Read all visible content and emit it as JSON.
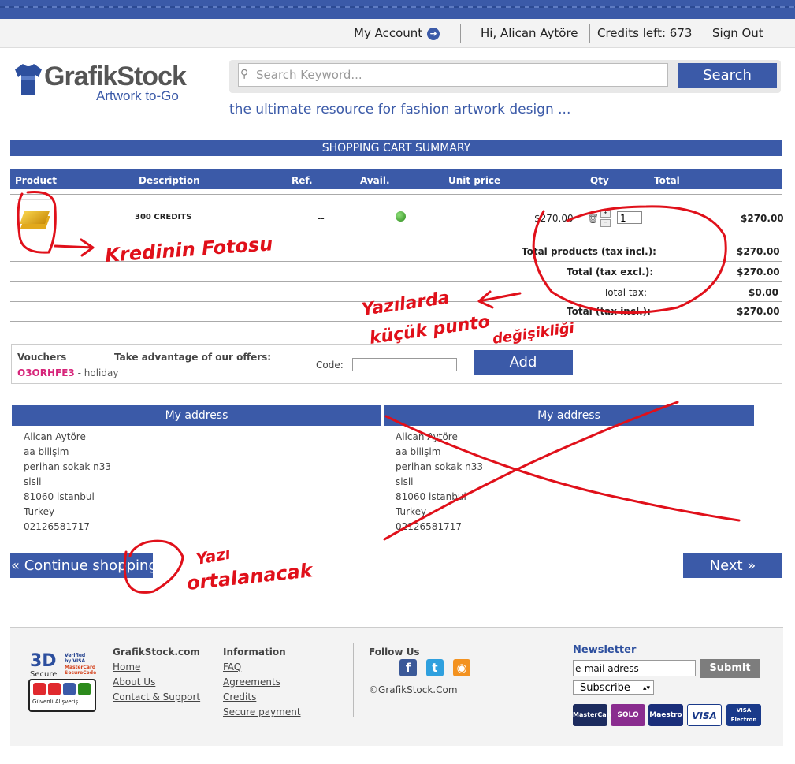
{
  "topbar": {
    "my_account": "My Account",
    "greeting": "Hi, Alican Aytöre",
    "credits": "Credits left: 673",
    "sign_out": "Sign Out"
  },
  "header": {
    "logo_text": "GrafikStock",
    "logo_sub": "Artwork to-Go",
    "search_placeholder": "Search Keyword...",
    "search_button": "Search",
    "tagline": "the ultimate resource for fashion artwork design ..."
  },
  "cart": {
    "title": "SHOPPING CART SUMMARY",
    "columns": [
      "Product",
      "Description",
      "Ref.",
      "Avail.",
      "Unit price",
      "Qty",
      "Total"
    ],
    "item": {
      "description": "300 CREDITS",
      "ref": "--",
      "unit_price": "$270.00",
      "qty": "1",
      "total": "$270.00"
    },
    "totals": [
      {
        "label": "Total products (tax incl.):",
        "value": "$270.00"
      },
      {
        "label": "Total (tax excl.):",
        "value": "$270.00"
      },
      {
        "label": "Total tax:",
        "value": "$0.00"
      },
      {
        "label": "Total (tax incl.):",
        "value": "$270.00"
      }
    ]
  },
  "vouchers": {
    "title": "Vouchers",
    "offers": "Take advantage of our offers:",
    "code_name": "O3ORHFE3",
    "code_desc": "- holiday",
    "code_label": "Code:",
    "add_button": "Add"
  },
  "addresses": {
    "left_title": "My address",
    "right_title": "My address",
    "lines": [
      "Alican Aytöre",
      "aa bilişim",
      "perihan sokak n33",
      "sisli",
      "81060 istanbul",
      "Turkey",
      "02126581717"
    ]
  },
  "nav": {
    "continue": "« Continue shopping",
    "next": "Next »"
  },
  "annotations": {
    "photo_note": "Kredinin Fotosu",
    "font_note_1": "Yazılarda",
    "font_note_2": "küçük punto",
    "font_note_3": "değişikliği",
    "center_note_1": "Yazı",
    "center_note_2": "ortalanacak"
  },
  "footer": {
    "badge_3d": "3D",
    "badge_secure": "Secure",
    "badge_verified": "Verified by VISA",
    "badge_mc": "MasterCard SecureCode",
    "badge_guvenli": "Güvenli Alışveriş",
    "site_title": "GrafikStock.com",
    "site_links": [
      "Home",
      "About Us",
      "Contact & Support"
    ],
    "info_title": "Information",
    "info_links": [
      "FAQ",
      "Agreements",
      "Credits",
      "Secure payment"
    ],
    "follow_title": "Follow Us",
    "copyright": "©GrafikStock.Com",
    "newsletter_title": "Newsletter",
    "email_value": "e-mail adress",
    "submit": "Submit",
    "subscribe_option": "Subscribe",
    "cards": [
      "MasterCard",
      "SOLO",
      "Maestro",
      "VISA",
      "VISA Electron"
    ]
  },
  "colors": {
    "brand_blue": "#3b5aa8",
    "annotation_red": "#e0101a",
    "voucher_pink": "#d6257a"
  }
}
